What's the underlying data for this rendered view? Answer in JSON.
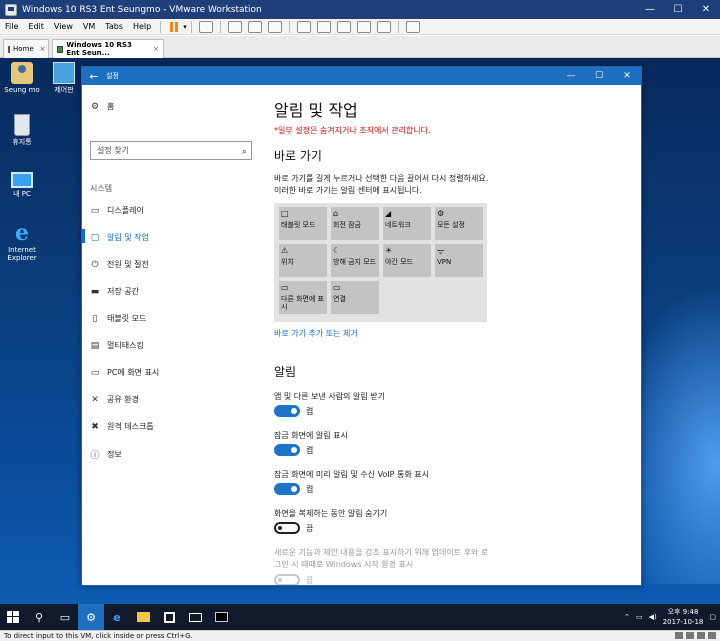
{
  "vmware": {
    "title": "Windows 10 RS3 Ent Seungmo - VMware Workstation",
    "menu": [
      "File",
      "Edit",
      "View",
      "VM",
      "Tabs",
      "Help"
    ],
    "tabs": [
      {
        "label": "Home"
      },
      {
        "label": "Windows 10 RS3 Ent Seun..."
      }
    ],
    "status": "To direct input to this VM, click inside or press Ctrl+G."
  },
  "desktop": {
    "icons": [
      {
        "label": "Seung mo",
        "icon": "user-folder-icon"
      },
      {
        "label": "제어판",
        "icon": "control-panel-icon"
      },
      {
        "label": "휴지통",
        "icon": "recycle-bin-icon"
      },
      {
        "label": "내 PC",
        "icon": "this-pc-icon"
      },
      {
        "label": "Internet Explorer",
        "icon": "internet-explorer-icon"
      }
    ]
  },
  "settings": {
    "window_title": "설정",
    "nav": {
      "home": "홈",
      "search_placeholder": "설정 찾기",
      "section": "시스템",
      "items": [
        {
          "label": "디스플레이",
          "icon": "monitor-icon"
        },
        {
          "label": "알림 및 작업",
          "icon": "notification-icon",
          "active": true
        },
        {
          "label": "전원 및 절전",
          "icon": "power-icon"
        },
        {
          "label": "저장 공간",
          "icon": "storage-icon"
        },
        {
          "label": "태블릿 모드",
          "icon": "tablet-icon"
        },
        {
          "label": "멀티태스킹",
          "icon": "multitask-icon"
        },
        {
          "label": "PC에 화면 표시",
          "icon": "project-icon"
        },
        {
          "label": "공유 환경",
          "icon": "share-icon"
        },
        {
          "label": "원격 데스크톱",
          "icon": "remote-icon"
        },
        {
          "label": "정보",
          "icon": "info-icon"
        }
      ]
    },
    "content": {
      "title": "알림 및 작업",
      "managed_notice": "*일부 설정은 숨겨지거나 조직에서 관리합니다.",
      "quick_actions_heading": "바로 가기",
      "qa_desc_line1": "바로 가기를 길게 누르거나 선택한 다음 끌어서 다시 정렬하세요.",
      "qa_desc_line2": "이러한 바로 가기는 알림 센터에 표시됩니다.",
      "tiles": [
        {
          "label": "태블릿 모드",
          "icon": "□"
        },
        {
          "label": "회전 잠금",
          "icon": "⌂"
        },
        {
          "label": "네트워크",
          "icon": "◢"
        },
        {
          "label": "모든 설정",
          "icon": "⚙"
        },
        {
          "label": "위치",
          "icon": "⚠"
        },
        {
          "label": "방해 금지 모드",
          "icon": "☾"
        },
        {
          "label": "야간 모드",
          "icon": "☀"
        },
        {
          "label": "VPN",
          "icon": "ᯤ"
        },
        {
          "label": "다른 화면에 표시",
          "icon": "▭"
        },
        {
          "label": "연결",
          "icon": "▭"
        }
      ],
      "qa_link": "바로 가기 추가 또는 제거",
      "notifications_heading": "알림",
      "toggles": [
        {
          "label": "앱 및 다른 보낸 사람의 알림 받기",
          "state": "켬",
          "on": true
        },
        {
          "label": "잠금 화면에 알림 표시",
          "state": "켬",
          "on": true
        },
        {
          "label": "잠금 화면에 미리 알림 및 수신 VoIP 통화 표시",
          "state": "켬",
          "on": true
        },
        {
          "label": "화면을 복제하는 동안 알림 숨기기",
          "state": "끔",
          "on": false
        }
      ],
      "disabled_line1": "새로운 기능과 제안 내용을 강조 표시하기 위해 업데이트 후와 로",
      "disabled_line2": "그인 시 때때로 Windows 시작 환경 표시",
      "disabled_state": "끔"
    }
  },
  "taskbar": {
    "time": "오후 9:48",
    "date": "2017-10-18"
  }
}
